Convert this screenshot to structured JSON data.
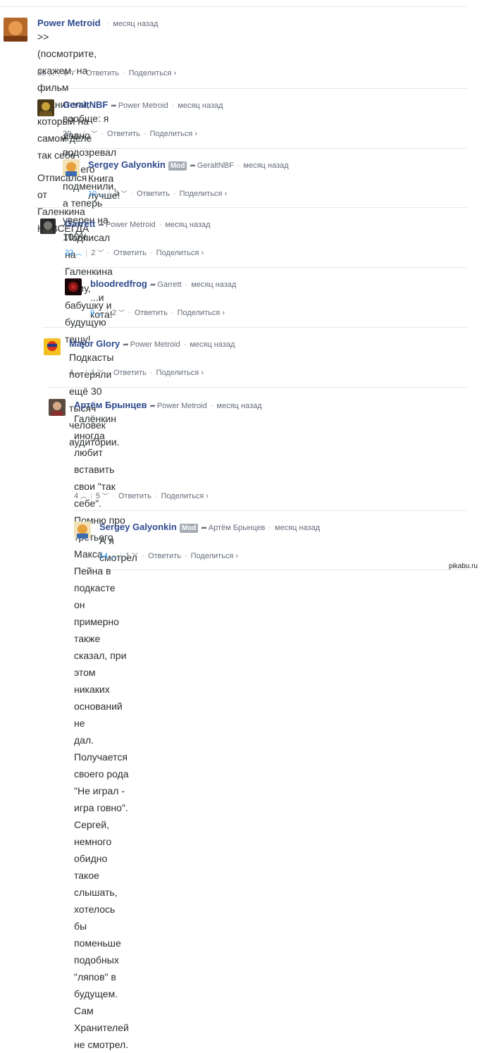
{
  "comments": [
    {
      "author": "Power Metroid",
      "reply_to": "",
      "mod": "",
      "time": "месяц назад",
      "lines": [
        ">>(посмотрите, скажем, на фильм Хранители, который на самом деле так себе",
        "",
        "Отписался от Галенкина НАВСЕГДА"
      ],
      "up": "89",
      "down": "6",
      "reply": "Ответить",
      "share": "Поделиться ›"
    },
    {
      "author": "GeraltNBF",
      "reply_to": "Power Metroid",
      "mod": "",
      "time": "месяц назад",
      "lines": [
        "вообще: я давно подозревал что его подменили, а теперь уверен на 100%"
      ],
      "up": "29",
      "down": "",
      "reply": "Ответить",
      "share": "Поделиться ›"
    },
    {
      "author": "Sergey Galyonkin",
      "reply_to": "GeraltNBF",
      "mod": "Mod",
      "time": "месяц назад",
      "lines": [
        "Книга лучше!"
      ],
      "up": "10",
      "down": "3",
      "reply": "Ответить",
      "share": "Поделиться ›"
    },
    {
      "author": "Garrett",
      "reply_to": "Power Metroid",
      "mod": "",
      "time": "месяц назад",
      "lines": [
        "Подписал на Галенкина маму, бабушку и будущую тещу!"
      ],
      "up": "22",
      "down": "2",
      "reply": "Ответить",
      "share": "Поделиться ›"
    },
    {
      "author": "bloodredfrog",
      "reply_to": "Garrett",
      "mod": "",
      "time": "месяц назад",
      "lines": [
        "...и кота!"
      ],
      "up": "9",
      "down": "2",
      "reply": "Ответить",
      "share": "Поделиться ›"
    },
    {
      "author": "Major Glory",
      "reply_to": "Power Metroid",
      "mod": "",
      "time": "месяц назад",
      "lines": [
        "Подкасты потеряли ещё 30 тысяч человек аудитории."
      ],
      "up": "4",
      "down": "1",
      "reply": "Ответить",
      "share": "Поделиться ›"
    },
    {
      "author": "Артём Брынцев",
      "reply_to": "Power Metroid",
      "mod": "",
      "time": "месяц назад",
      "lines": [
        "Галёнкин иногда любит вставить свои \"так себе\". Помню про третьего",
        "Макса Пейна в подкасте он примерно также сказал, при этом никаких оснований не",
        "дал. Получается своего рода \"Не играл - игра говно\". Сергей, немного обидно",
        "такое слышать, хотелось бы поменьше подобных \"ляпов\" в будущем. Сам",
        "Хранителей не смотрел."
      ],
      "up": "4",
      "down": "5",
      "reply": "Ответить",
      "share": "Поделиться ›"
    },
    {
      "author": "Sergey Galyonkin",
      "reply_to": "Артём Брынцев",
      "mod": "Mod",
      "time": "месяц назад",
      "lines": [
        "А я смотрел"
      ],
      "up": "14",
      "down": "1",
      "reply": "Ответить",
      "share": "Поделиться ›"
    }
  ],
  "watermark": "pikabu.ru",
  "colors": {
    "author": "#2e4a8e",
    "upvote_active": "#2e9fff",
    "meta": "#656c7a",
    "divider": "#e7e9ee"
  },
  "avatar_icons": [
    "avatar-orange-face",
    "avatar-witcher",
    "avatar-cartoon",
    "avatar-thief",
    "avatar-red-dark",
    "avatar-comic-hero",
    "avatar-photo",
    "avatar-cartoon"
  ]
}
